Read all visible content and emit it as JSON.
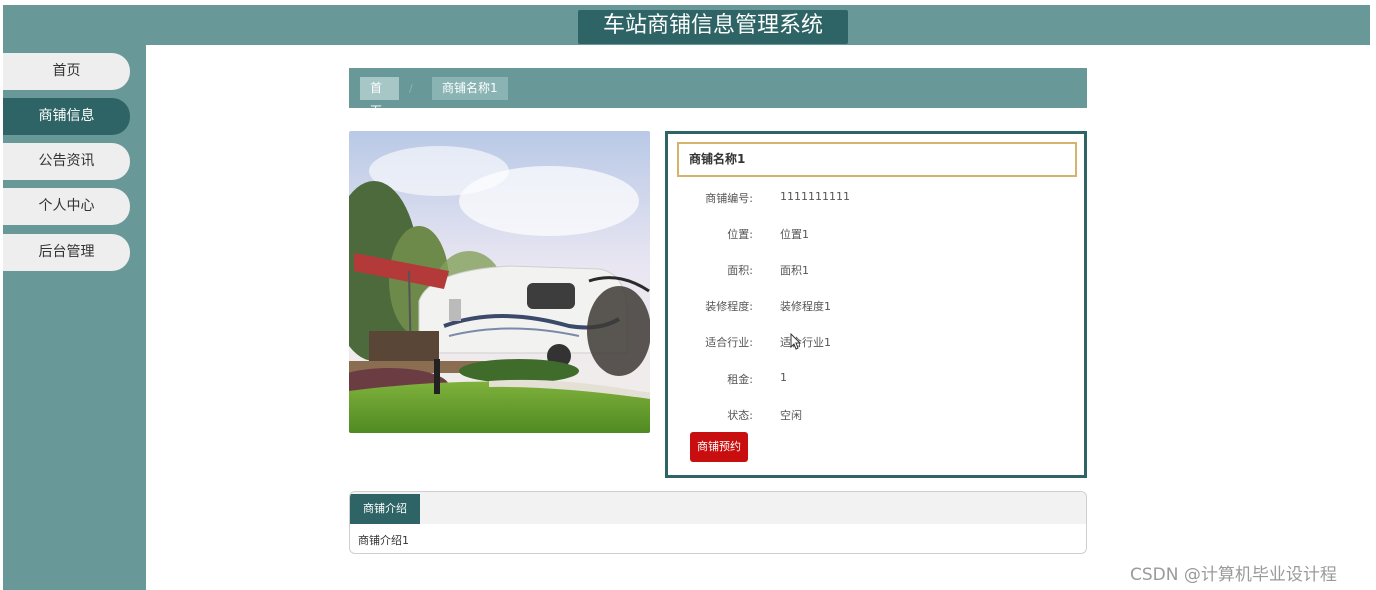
{
  "header": {
    "title": "车站商铺信息管理系统"
  },
  "sidebar": {
    "items": [
      {
        "label": "首页",
        "active": false
      },
      {
        "label": "商铺信息",
        "active": true
      },
      {
        "label": "公告资讯",
        "active": false
      },
      {
        "label": "个人中心",
        "active": false
      },
      {
        "label": "后台管理",
        "active": false
      }
    ]
  },
  "breadcrumb": {
    "home": "首页",
    "separator": "/",
    "current": "商铺名称1"
  },
  "shop": {
    "name": "商铺名称1",
    "fields": [
      {
        "label": "商铺编号:",
        "value": "1111111111"
      },
      {
        "label": "位置:",
        "value": "位置1"
      },
      {
        "label": "面积:",
        "value": "面积1"
      },
      {
        "label": "装修程度:",
        "value": "装修程度1"
      },
      {
        "label": "适合行业:",
        "value": "适合行业1"
      },
      {
        "label": "租金:",
        "value": "1"
      },
      {
        "label": "状态:",
        "value": "空闲"
      }
    ],
    "reserve_label": "商铺预约"
  },
  "intro": {
    "tab_label": "商铺介绍",
    "content": "商铺介绍1"
  },
  "watermark": "CSDN @计算机毕业设计程",
  "colors": {
    "primary": "#689898",
    "dark": "#2e6465",
    "accent_border": "#d4b36a",
    "button_red": "#c80e0e"
  }
}
